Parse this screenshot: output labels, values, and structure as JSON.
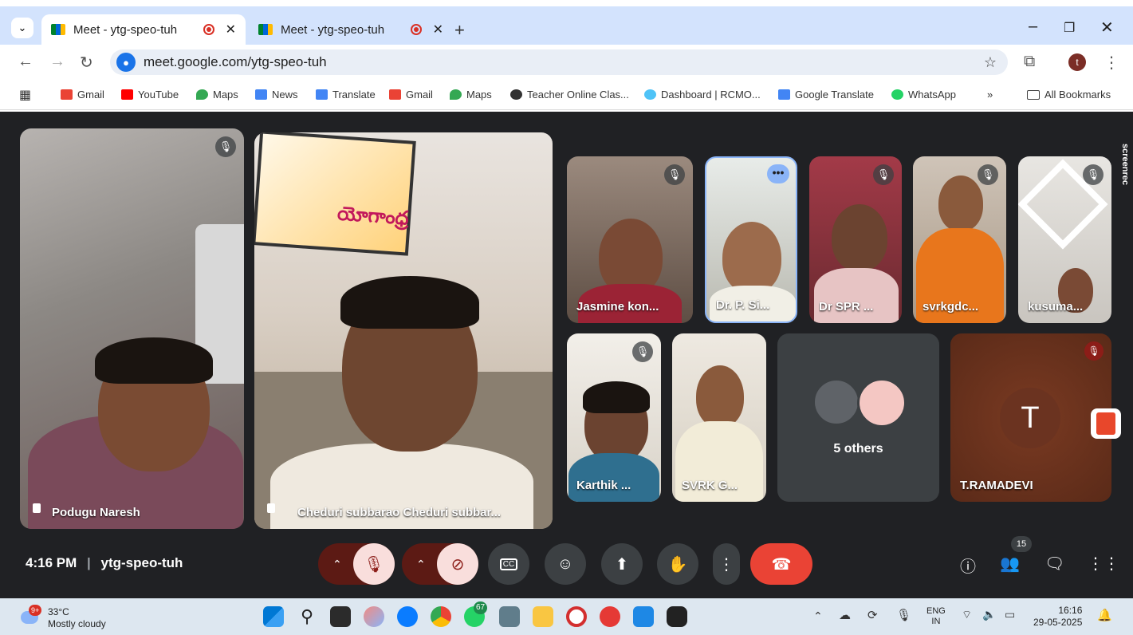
{
  "browser": {
    "tabs": [
      {
        "title": "Meet - ytg-speo-tuh",
        "active": true
      },
      {
        "title": "Meet - ytg-speo-tuh",
        "active": false
      }
    ],
    "new_tab": "+",
    "url": "meet.google.com/ytg-speo-tuh",
    "profile_initial": "t",
    "bookmarks": [
      "Gmail",
      "YouTube",
      "Maps",
      "News",
      "Translate",
      "Gmail",
      "Maps",
      "Teacher Online Clas...",
      "Dashboard | RCMO...",
      "Google Translate",
      "WhatsApp"
    ],
    "more_bookmarks": "»",
    "all_bookmarks": "All Bookmarks"
  },
  "meet": {
    "participants": [
      {
        "name": "Podugu Naresh"
      },
      {
        "name": "Cheduri subbarao Cheduri subbar..."
      },
      {
        "name": "Jasmine kon..."
      },
      {
        "name": "Dr. P. Si..."
      },
      {
        "name": "Dr SPR ..."
      },
      {
        "name": "svrkgdc..."
      },
      {
        "name": "kusuma..."
      },
      {
        "name": "Karthik ..."
      },
      {
        "name": "SVRK G..."
      },
      {
        "name": "T.RAMADEVI",
        "initial": "T"
      }
    ],
    "others_label": "5 others",
    "time": "4:16 PM",
    "meeting_code": "ytg-speo-tuh",
    "people_count": "15",
    "poster_text": "యోగాంధ్ర",
    "side_label": "screenrec"
  },
  "taskbar": {
    "weather_temp": "33°C",
    "weather_desc": "Mostly cloudy",
    "weather_badge": "9+",
    "whatsapp_badge": "67",
    "lang_top": "ENG",
    "lang_bottom": "IN",
    "clock_time": "16:16",
    "clock_date": "29-05-2025"
  },
  "colors": {
    "meet_bg": "#202124",
    "end_call": "#ea4335",
    "mic_off": "#8c1d18",
    "tab_strip": "#d3e3fd"
  }
}
